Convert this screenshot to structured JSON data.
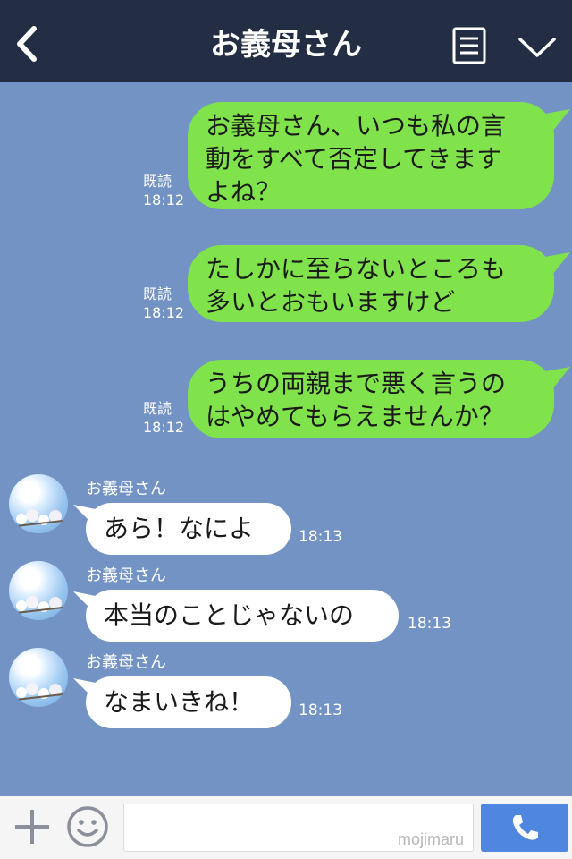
{
  "header": {
    "title": "お義母さん",
    "back_icon": "chevron-left-icon",
    "menu_icon": "menu-icon",
    "expand_icon": "chevron-down-icon"
  },
  "messages_out": [
    {
      "text_lines": [
        "お義母さん、いつも私の言",
        "動をすべて否定してきます",
        "よね？"
      ],
      "read": "既読",
      "time": "18:12"
    },
    {
      "text_lines": [
        "たしかに至らないところも",
        "多いとおもいますけど"
      ],
      "read": "既読",
      "time": "18:12"
    },
    {
      "text_lines": [
        "うちの両親まで悪く言うの",
        "はやめてもらえませんか？"
      ],
      "read": "既読",
      "time": "18:12"
    }
  ],
  "messages_in": [
    {
      "sender": "お義母さん",
      "text": "あら！なによ",
      "time": "18:13"
    },
    {
      "sender": "お義母さん",
      "text": "本当のことじゃないの",
      "time": "18:13"
    },
    {
      "sender": "お義母さん",
      "text": "なまいきね！",
      "time": "18:13"
    }
  ],
  "footer": {
    "input_value": "",
    "watermark": "mojimaru",
    "plus_icon": "plus-icon",
    "emoji_icon": "smile-icon",
    "call_icon": "phone-icon"
  },
  "colors": {
    "header_bg": "#232d44",
    "chat_bg": "#7293c4",
    "out_bubble": "#80e34b",
    "in_bubble": "#ffffff",
    "call_button": "#4f87e0"
  }
}
